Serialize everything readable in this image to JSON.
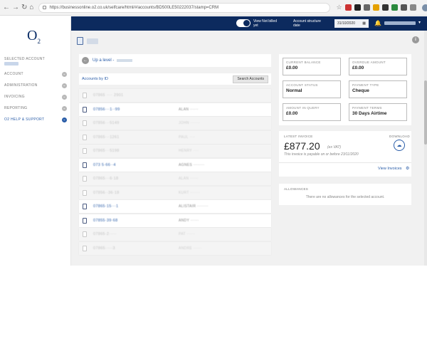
{
  "browser": {
    "url": "https://businessonline.o2.co.uk/selfcare/html/#/accounts/BD500LE50222037/stamp=CRM"
  },
  "app": {
    "logo": "O",
    "logo_sub": "2",
    "selected_account_label": "SELECTED ACCOUNT",
    "nav": [
      {
        "label": "ACCOUNT",
        "chevron": "⌄"
      },
      {
        "label": "ADMINISTRATION",
        "chevron": "⌄"
      },
      {
        "label": "INVOICING",
        "chevron": "⌄"
      },
      {
        "label": "REPORTING",
        "chevron": "⌄"
      },
      {
        "label": "O2 HELP & SUPPORT",
        "chevron": "⌄"
      }
    ]
  },
  "topbar": {
    "toggle_label": "View Not billed yet",
    "structure_label": "Account structure date",
    "date": "31/10/2020",
    "caret": "▾"
  },
  "main": {
    "up_level": "Up a level -",
    "accounts_title": "Accounts by ID",
    "search_button": "Search Accounts",
    "info": "i",
    "rows": [
      {
        "num": "07865 ···· 2901",
        "name": "",
        "faded": true
      },
      {
        "num": "07856···1··99",
        "name": "ALAN ······",
        "faded": false
      },
      {
        "num": "07856···5149",
        "name": "JOHN ·······",
        "faded": true
      },
      {
        "num": "07865···1261",
        "name": "PAUL ····",
        "faded": true
      },
      {
        "num": "07865···5198",
        "name": "HENRY ····",
        "faded": true
      },
      {
        "num": "073 5·66··4",
        "name": "AGNES ········",
        "faded": false
      },
      {
        "num": "07865···6·18",
        "name": "ALAN ······",
        "faded": true
      },
      {
        "num": "07856··36·18",
        "name": "KURT ·······",
        "faded": true
      },
      {
        "num": "07865·15···1",
        "name": "ALISTAIR ········",
        "faded": false
      },
      {
        "num": "07855·39·68",
        "name": "ANDY ······",
        "faded": false
      },
      {
        "num": "07865·2·····",
        "name": "PAT ······",
        "faded": true
      },
      {
        "num": "07865·····3",
        "name": "ANDRE ······",
        "faded": true
      }
    ]
  },
  "stats": [
    {
      "label": "CURRENT BALANCE",
      "value": "£0.00"
    },
    {
      "label": "OVERDUE AMOUNT",
      "value": "£0.00"
    },
    {
      "label": "ACCOUNT STATUS",
      "value": "Normal"
    },
    {
      "label": "PAYMENT TYPE",
      "value": "Cheque"
    },
    {
      "label": "AMOUNT IN QUERY",
      "value": "£0.00"
    },
    {
      "label": "PAYMENT TERMS",
      "value": "30 Days Airtime"
    }
  ],
  "invoice": {
    "label": "LATEST INVOICE",
    "amount": "£877.20",
    "vat": "(ex VAT)",
    "due": "This invoice is payable on or before 23/11/2020",
    "download_label": "DOWNLOAD",
    "view_link": "View Invoices"
  },
  "allowances": {
    "label": "ALLOWANCES",
    "text": "There are no allowances for the selected account."
  },
  "colors": {
    "brand_navy": "#0c2a5e",
    "link_blue": "#2a5da8"
  }
}
